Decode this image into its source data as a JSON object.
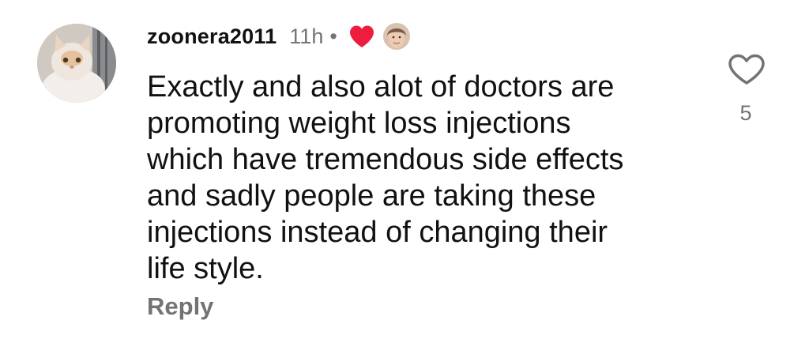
{
  "comment": {
    "username": "zoonera2011",
    "time": "11h",
    "separator": "•",
    "text": "Exactly and also alot of doctors are\npromoting weight loss injections\nwhich have tremendous side effects\nand sadly people are taking these\ninjections instead of changing their\nlife style.",
    "reply_label": "Reply",
    "like_count": "5",
    "icons": {
      "avatar": "cat-avatar",
      "creator_heart": "heart-icon",
      "creator_avatar": "creator-avatar",
      "like": "heart-outline-icon"
    },
    "colors": {
      "heart": "#ee1d3f",
      "secondary_text": "#737373"
    }
  }
}
